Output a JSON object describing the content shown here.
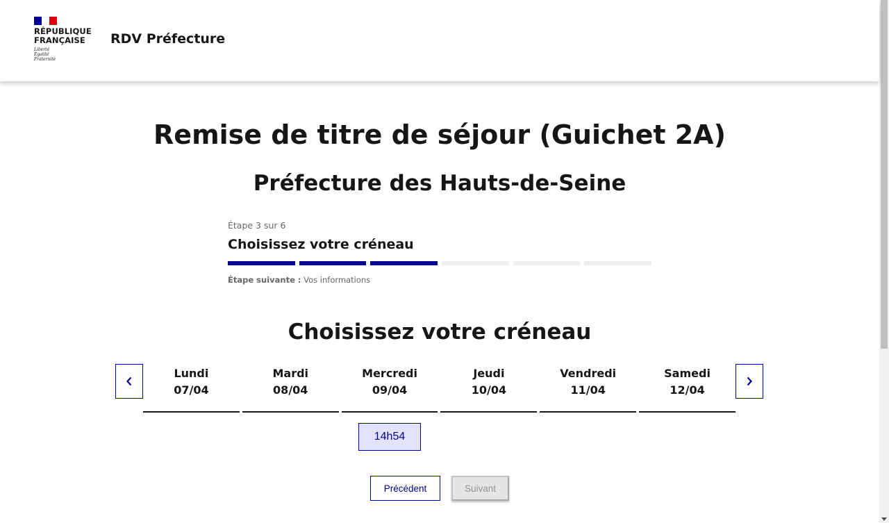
{
  "header": {
    "logo_line1": "RÉPUBLIQUE",
    "logo_line2": "FRANÇAISE",
    "motto1": "Liberté",
    "motto2": "Égalité",
    "motto3": "Fraternité",
    "site_title": "RDV Préfecture"
  },
  "page": {
    "title": "Remise de titre de séjour (Guichet 2A)",
    "subtitle": "Préfecture des Hauts-de-Seine"
  },
  "stepper": {
    "count": "Étape 3 sur 6",
    "title": "Choisissez votre créneau",
    "current_step": 3,
    "total_steps": 6,
    "next_label": "Étape suivante :",
    "next_value": "Vos informations"
  },
  "calendar": {
    "title": "Choisissez votre créneau",
    "days": [
      {
        "name": "Lundi",
        "date": "07/04"
      },
      {
        "name": "Mardi",
        "date": "08/04"
      },
      {
        "name": "Mercredi",
        "date": "09/04"
      },
      {
        "name": "Jeudi",
        "date": "10/04"
      },
      {
        "name": "Vendredi",
        "date": "11/04"
      },
      {
        "name": "Samedi",
        "date": "12/04"
      }
    ],
    "slot": "14h54",
    "prev_icon": "chevron-left-icon",
    "next_icon": "chevron-right-icon"
  },
  "actions": {
    "previous": "Précédent",
    "next": "Suivant"
  },
  "colors": {
    "brand_blue": "#000091",
    "marianne_red": "#e1000f",
    "slot_bg": "#e3e3fd",
    "disabled_bg": "#e5e5e5"
  }
}
